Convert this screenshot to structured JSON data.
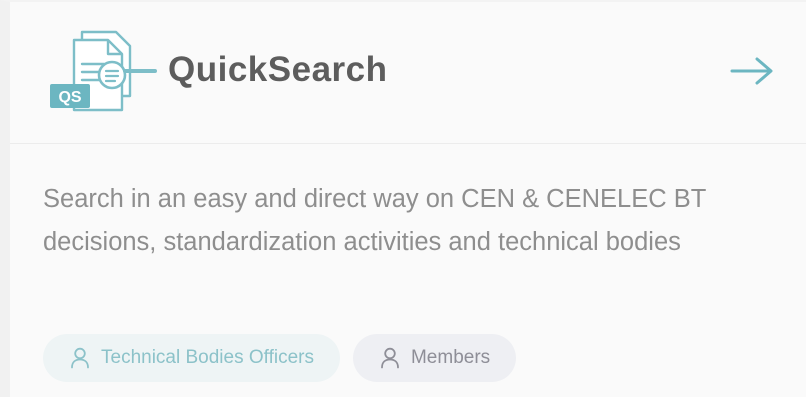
{
  "card": {
    "title": "QuickSearch",
    "logo": {
      "icon": "document-search-icon",
      "badge_text": "QS",
      "accent_color": "#6cb6c1"
    },
    "arrow": {
      "icon": "arrow-right-icon",
      "color": "#6cb6c1"
    },
    "description": "Search in an easy and direct way on CEN & CENELEC BT decisions, standardization activities and technical bodies",
    "tags": [
      {
        "label": "Technical Bodies Officers",
        "icon": "user-icon",
        "color": "#8cc2c9",
        "background": "#eef4f5"
      },
      {
        "label": "Members",
        "icon": "user-icon",
        "color": "#8e8e97",
        "background": "#eeeff3"
      }
    ]
  }
}
